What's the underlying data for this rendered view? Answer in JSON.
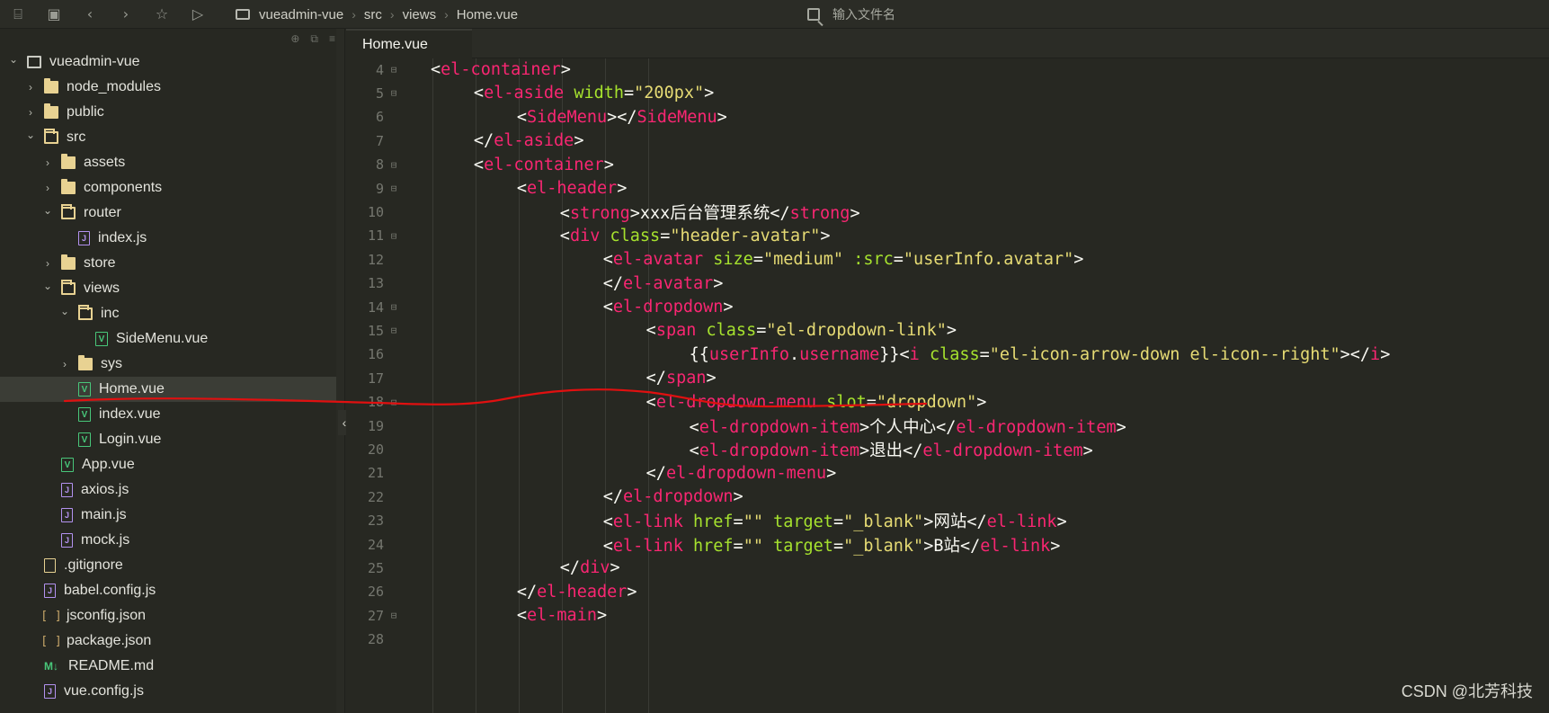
{
  "toolbar": {
    "icons": [
      "save-all-icon",
      "save-icon",
      "back-icon",
      "forward-icon",
      "star-icon",
      "run-icon"
    ],
    "breadcrumb": [
      "vueadmin-vue",
      "src",
      "views",
      "Home.vue"
    ],
    "search_placeholder": "输入文件名"
  },
  "sidebar": {
    "items": [
      {
        "label": "vueadmin-vue",
        "depth": 0,
        "chevron": "down",
        "icon": "project"
      },
      {
        "label": "node_modules",
        "depth": 1,
        "chevron": "right",
        "icon": "folder"
      },
      {
        "label": "public",
        "depth": 1,
        "chevron": "right",
        "icon": "folder"
      },
      {
        "label": "src",
        "depth": 1,
        "chevron": "down",
        "icon": "folder-open"
      },
      {
        "label": "assets",
        "depth": 2,
        "chevron": "right",
        "icon": "folder"
      },
      {
        "label": "components",
        "depth": 2,
        "chevron": "right",
        "icon": "folder"
      },
      {
        "label": "router",
        "depth": 2,
        "chevron": "down",
        "icon": "folder-open"
      },
      {
        "label": "index.js",
        "depth": 3,
        "chevron": "none",
        "icon": "js"
      },
      {
        "label": "store",
        "depth": 2,
        "chevron": "right",
        "icon": "folder"
      },
      {
        "label": "views",
        "depth": 2,
        "chevron": "down",
        "icon": "folder-open"
      },
      {
        "label": "inc",
        "depth": 3,
        "chevron": "down",
        "icon": "folder-open"
      },
      {
        "label": "SideMenu.vue",
        "depth": 4,
        "chevron": "none",
        "icon": "vue"
      },
      {
        "label": "sys",
        "depth": 3,
        "chevron": "right",
        "icon": "folder"
      },
      {
        "label": "Home.vue",
        "depth": 3,
        "chevron": "none",
        "icon": "vue",
        "selected": true
      },
      {
        "label": "index.vue",
        "depth": 3,
        "chevron": "none",
        "icon": "vue"
      },
      {
        "label": "Login.vue",
        "depth": 3,
        "chevron": "none",
        "icon": "vue"
      },
      {
        "label": "App.vue",
        "depth": 2,
        "chevron": "none",
        "icon": "vue"
      },
      {
        "label": "axios.js",
        "depth": 2,
        "chevron": "none",
        "icon": "js"
      },
      {
        "label": "main.js",
        "depth": 2,
        "chevron": "none",
        "icon": "js"
      },
      {
        "label": "mock.js",
        "depth": 2,
        "chevron": "none",
        "icon": "js"
      },
      {
        "label": ".gitignore",
        "depth": 1,
        "chevron": "none",
        "icon": "file"
      },
      {
        "label": "babel.config.js",
        "depth": 1,
        "chevron": "none",
        "icon": "js"
      },
      {
        "label": "jsconfig.json",
        "depth": 1,
        "chevron": "none",
        "icon": "json"
      },
      {
        "label": "package.json",
        "depth": 1,
        "chevron": "none",
        "icon": "json"
      },
      {
        "label": "README.md",
        "depth": 1,
        "chevron": "none",
        "icon": "md"
      },
      {
        "label": "vue.config.js",
        "depth": 1,
        "chevron": "none",
        "icon": "js"
      }
    ]
  },
  "editor": {
    "tab_label": "Home.vue",
    "lines": [
      {
        "n": "4",
        "fold": true,
        "indent": 0,
        "tokens": [
          [
            "t",
            "<"
          ],
          [
            "tag",
            "el-container"
          ],
          [
            "t",
            ">"
          ]
        ]
      },
      {
        "n": "5",
        "fold": true,
        "indent": 1,
        "tokens": [
          [
            "t",
            "<"
          ],
          [
            "tag",
            "el-aside"
          ],
          [
            "t",
            " "
          ],
          [
            "an",
            "width"
          ],
          [
            "t",
            "="
          ],
          [
            "av",
            "\"200px\""
          ],
          [
            "t",
            ">"
          ]
        ]
      },
      {
        "n": "6",
        "fold": false,
        "indent": 2,
        "tokens": [
          [
            "t",
            "<"
          ],
          [
            "tag",
            "SideMenu"
          ],
          [
            "t",
            "></"
          ],
          [
            "tag",
            "SideMenu"
          ],
          [
            "t",
            ">"
          ]
        ]
      },
      {
        "n": "7",
        "fold": false,
        "indent": 1,
        "tokens": [
          [
            "t",
            "</"
          ],
          [
            "tag",
            "el-aside"
          ],
          [
            "t",
            ">"
          ]
        ]
      },
      {
        "n": "8",
        "fold": true,
        "indent": 1,
        "tokens": [
          [
            "t",
            "<"
          ],
          [
            "tag",
            "el-container"
          ],
          [
            "t",
            ">"
          ]
        ]
      },
      {
        "n": "9",
        "fold": true,
        "indent": 2,
        "tokens": [
          [
            "t",
            "<"
          ],
          [
            "tag",
            "el-header"
          ],
          [
            "t",
            ">"
          ]
        ]
      },
      {
        "n": "10",
        "fold": false,
        "indent": 3,
        "tokens": [
          [
            "t",
            "<"
          ],
          [
            "tag",
            "strong"
          ],
          [
            "t",
            ">xxx后台管理系统</"
          ],
          [
            "tag",
            "strong"
          ],
          [
            "t",
            ">"
          ]
        ]
      },
      {
        "n": "11",
        "fold": true,
        "indent": 3,
        "tokens": [
          [
            "t",
            "<"
          ],
          [
            "tag",
            "div"
          ],
          [
            "t",
            " "
          ],
          [
            "an",
            "class"
          ],
          [
            "t",
            "="
          ],
          [
            "av",
            "\"header-avatar\""
          ],
          [
            "t",
            ">"
          ]
        ]
      },
      {
        "n": "12",
        "fold": false,
        "indent": 4,
        "tokens": [
          [
            "t",
            "<"
          ],
          [
            "tag",
            "el-avatar"
          ],
          [
            "t",
            " "
          ],
          [
            "an",
            "size"
          ],
          [
            "t",
            "="
          ],
          [
            "av",
            "\"medium\""
          ],
          [
            "t",
            " "
          ],
          [
            "an",
            ":src"
          ],
          [
            "t",
            "="
          ],
          [
            "av",
            "\"userInfo.avatar\""
          ],
          [
            "t",
            ">"
          ]
        ]
      },
      {
        "n": "13",
        "fold": false,
        "indent": 4,
        "tokens": [
          [
            "t",
            "</"
          ],
          [
            "tag",
            "el-avatar"
          ],
          [
            "t",
            ">"
          ]
        ]
      },
      {
        "n": "14",
        "fold": true,
        "indent": 4,
        "tokens": [
          [
            "t",
            "<"
          ],
          [
            "tag",
            "el-dropdown"
          ],
          [
            "t",
            ">"
          ]
        ]
      },
      {
        "n": "15",
        "fold": true,
        "indent": 5,
        "tokens": [
          [
            "t",
            "<"
          ],
          [
            "tag",
            "span"
          ],
          [
            "t",
            " "
          ],
          [
            "an",
            "class"
          ],
          [
            "t",
            "="
          ],
          [
            "av",
            "\"el-dropdown-link\""
          ],
          [
            "t",
            ">"
          ]
        ]
      },
      {
        "n": "16",
        "fold": false,
        "indent": 6,
        "tokens": [
          [
            "t",
            "{{"
          ],
          [
            "tag",
            "userInfo"
          ],
          [
            "t",
            "."
          ],
          [
            "tag",
            "username"
          ],
          [
            "t",
            "}}<"
          ],
          [
            "tag",
            "i"
          ],
          [
            "t",
            " "
          ],
          [
            "an",
            "class"
          ],
          [
            "t",
            "="
          ],
          [
            "av",
            "\"el-icon-arrow-down el-icon--right\""
          ],
          [
            "t",
            "></"
          ],
          [
            "tag",
            "i"
          ],
          [
            "t",
            ">"
          ]
        ]
      },
      {
        "n": "17",
        "fold": false,
        "indent": 5,
        "tokens": [
          [
            "t",
            "</"
          ],
          [
            "tag",
            "span"
          ],
          [
            "t",
            ">"
          ]
        ]
      },
      {
        "n": "18",
        "fold": true,
        "indent": 5,
        "tokens": [
          [
            "t",
            "<"
          ],
          [
            "tag",
            "el-dropdown-menu"
          ],
          [
            "t",
            " "
          ],
          [
            "an",
            "slot"
          ],
          [
            "t",
            "="
          ],
          [
            "av",
            "\"dropdown\""
          ],
          [
            "t",
            ">"
          ]
        ]
      },
      {
        "n": "19",
        "fold": false,
        "indent": 6,
        "tokens": [
          [
            "t",
            "<"
          ],
          [
            "tag",
            "el-dropdown-item"
          ],
          [
            "t",
            ">个人中心</"
          ],
          [
            "tag",
            "el-dropdown-item"
          ],
          [
            "t",
            ">"
          ]
        ]
      },
      {
        "n": "20",
        "fold": false,
        "indent": 6,
        "tokens": [
          [
            "t",
            "<"
          ],
          [
            "tag",
            "el-dropdown-item"
          ],
          [
            "t",
            ">退出</"
          ],
          [
            "tag",
            "el-dropdown-item"
          ],
          [
            "t",
            ">"
          ]
        ]
      },
      {
        "n": "21",
        "fold": false,
        "indent": 5,
        "tokens": [
          [
            "t",
            "</"
          ],
          [
            "tag",
            "el-dropdown-menu"
          ],
          [
            "t",
            ">"
          ]
        ]
      },
      {
        "n": "22",
        "fold": false,
        "indent": 4,
        "tokens": [
          [
            "t",
            "</"
          ],
          [
            "tag",
            "el-dropdown"
          ],
          [
            "t",
            ">"
          ]
        ]
      },
      {
        "n": "23",
        "fold": false,
        "indent": 4,
        "tokens": [
          [
            "t",
            "<"
          ],
          [
            "tag",
            "el-link"
          ],
          [
            "t",
            " "
          ],
          [
            "an",
            "href"
          ],
          [
            "t",
            "="
          ],
          [
            "av",
            "\"\""
          ],
          [
            "t",
            " "
          ],
          [
            "an",
            "target"
          ],
          [
            "t",
            "="
          ],
          [
            "av",
            "\"_blank\""
          ],
          [
            "t",
            ">网站</"
          ],
          [
            "tag",
            "el-link"
          ],
          [
            "t",
            ">"
          ]
        ]
      },
      {
        "n": "24",
        "fold": false,
        "indent": 4,
        "tokens": [
          [
            "t",
            "<"
          ],
          [
            "tag",
            "el-link"
          ],
          [
            "t",
            " "
          ],
          [
            "an",
            "href"
          ],
          [
            "t",
            "="
          ],
          [
            "av",
            "\"\""
          ],
          [
            "t",
            " "
          ],
          [
            "an",
            "target"
          ],
          [
            "t",
            "="
          ],
          [
            "av",
            "\"_blank\""
          ],
          [
            "t",
            ">B站</"
          ],
          [
            "tag",
            "el-link"
          ],
          [
            "t",
            ">"
          ]
        ]
      },
      {
        "n": "25",
        "fold": false,
        "indent": 3,
        "tokens": [
          [
            "t",
            "</"
          ],
          [
            "tag",
            "div"
          ],
          [
            "t",
            ">"
          ]
        ]
      },
      {
        "n": "26",
        "fold": false,
        "indent": 2,
        "tokens": [
          [
            "t",
            "</"
          ],
          [
            "tag",
            "el-header"
          ],
          [
            "t",
            ">"
          ]
        ]
      },
      {
        "n": "27",
        "fold": true,
        "indent": 2,
        "tokens": [
          [
            "t",
            "<"
          ],
          [
            "tag",
            "el-main"
          ],
          [
            "t",
            ">"
          ]
        ]
      },
      {
        "n": "28",
        "fold": false,
        "indent": 0,
        "tokens": []
      }
    ]
  },
  "watermark": "CSDN @北芳科技",
  "colors": {
    "background": "#272822",
    "tag": "#f92672",
    "attribute": "#a6e22e",
    "string": "#e6db74",
    "annotation": "#e01010"
  }
}
